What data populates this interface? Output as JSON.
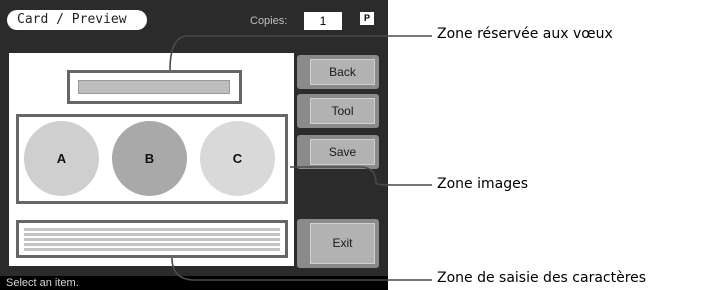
{
  "window": {
    "title": "Card / Preview",
    "copies_label": "Copies:",
    "copies_value": "1",
    "p_badge": "P"
  },
  "buttons": {
    "back": "Back",
    "tool": "Tool",
    "save": "Save",
    "exit": "Exit"
  },
  "images": [
    {
      "label": "A",
      "color": "#cfcfcf"
    },
    {
      "label": "B",
      "color": "#a9a9a9"
    },
    {
      "label": "C",
      "color": "#d9d9d9"
    }
  ],
  "status": "Select an item.",
  "callouts": {
    "greeting_zone": "Zone réservée aux vœux",
    "images_zone": "Zone images",
    "text_zone": "Zone de saisie des caractères"
  }
}
